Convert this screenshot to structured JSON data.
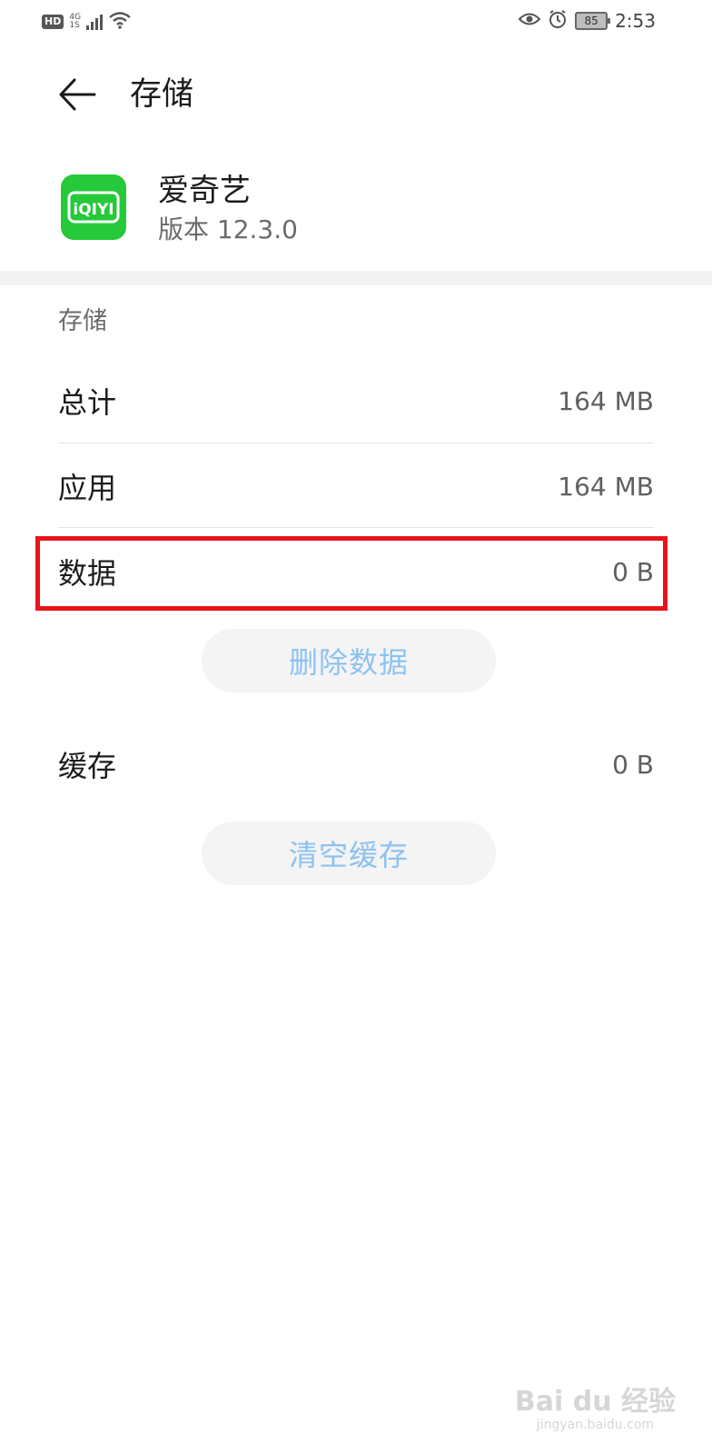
{
  "status_bar": {
    "hd": "HD",
    "network": "4G",
    "network_sub": "1S",
    "battery": "85",
    "time": "2:53",
    "icons": [
      "signal-icon",
      "wifi-icon",
      "eye-icon",
      "alarm-icon",
      "battery-icon"
    ]
  },
  "header": {
    "title": "存储",
    "back_icon": "back-arrow-icon"
  },
  "app": {
    "name": "爱奇艺",
    "version": "版本 12.3.0",
    "icon_text": "iQIYI",
    "icon_color": "#25c93a"
  },
  "storage": {
    "section_label": "存储",
    "rows": [
      {
        "label": "总计",
        "value": "164 MB"
      },
      {
        "label": "应用",
        "value": "164 MB"
      },
      {
        "label": "数据",
        "value": "0 B"
      },
      {
        "label": "缓存",
        "value": "0 B"
      }
    ],
    "clear_data_button": "删除数据",
    "clear_cache_button": "清空缓存"
  },
  "highlight": {
    "color": "#e8131b",
    "target": "数据"
  },
  "watermark": {
    "main": "Bai du 经验",
    "sub": "jingyan.baidu.com"
  }
}
